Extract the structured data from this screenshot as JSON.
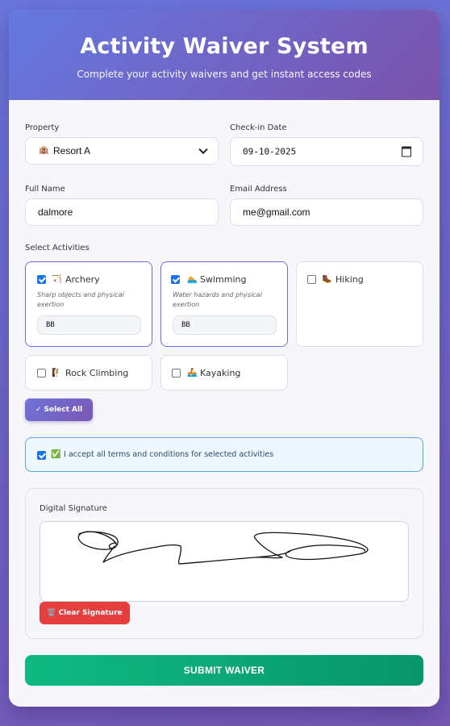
{
  "header": {
    "title": "Activity Waiver System",
    "subtitle": "Complete your activity waivers and get instant access codes"
  },
  "form": {
    "property_label": "Property",
    "property_value": "Resort A",
    "property_icon": "building-icon",
    "checkin_label": "Check-in Date",
    "checkin_value": "09-10-2025",
    "name_label": "Full Name",
    "name_value": "dalmore",
    "email_label": "Email Address",
    "email_value": "me@gmail.com"
  },
  "activities": {
    "label": "Select Activities",
    "items": [
      {
        "emoji": "🏹",
        "name": "Archery",
        "checked": true,
        "desc": "Sharp objects and physical exertion",
        "initials": "BB"
      },
      {
        "emoji": "🏊",
        "name": "Swimming",
        "checked": true,
        "desc": "Water hazards and physical exertion",
        "initials": "BB"
      },
      {
        "emoji": "🥾",
        "name": "Hiking",
        "checked": false
      },
      {
        "emoji": "🧗",
        "name": "Rock Climbing",
        "checked": false
      },
      {
        "emoji": "🚣",
        "name": "Kayaking",
        "checked": false
      }
    ],
    "select_all_label": "✓ Select All"
  },
  "terms": {
    "emoji": "✅",
    "text": "I accept all terms and conditions for selected activities",
    "checked": true
  },
  "signature": {
    "label": "Digital Signature",
    "clear_label": "🗑️ Clear Signature"
  },
  "submit_label": "SUBMIT WAIVER",
  "colors": {
    "accent": "#6a6fd6",
    "submit": "#10b981",
    "danger": "#e53e3e"
  }
}
